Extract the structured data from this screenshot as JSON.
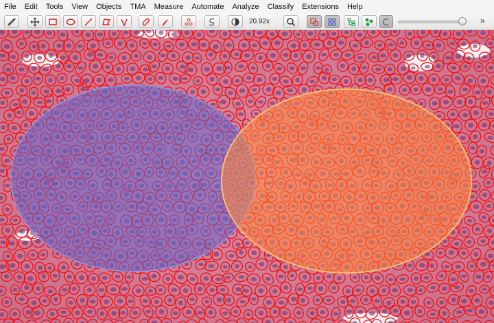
{
  "menu": [
    "File",
    "Edit",
    "Tools",
    "View",
    "Objects",
    "TMA",
    "Measure",
    "Automate",
    "Analyze",
    "Classify",
    "Extensions",
    "Help"
  ],
  "toolbar": {
    "zoom_label": "20.92x",
    "tools": [
      "move",
      "rectangle",
      "ellipse",
      "line",
      "polygon",
      "polyline",
      "brush",
      "wand",
      "points",
      "selection-mode",
      "brightness-contrast",
      "zoom-to-fit",
      "show-annotations",
      "show-tma-grid",
      "show-detections",
      "fill-detections",
      "show-pixel-classification"
    ]
  },
  "slider": {
    "opacity": 0.94
  },
  "colors": {
    "detection_outline": "#ee1111",
    "annotation_blue": "#5d6ad6",
    "annotation_orange": "#ff8a3d",
    "tissue": "#d27b95"
  }
}
